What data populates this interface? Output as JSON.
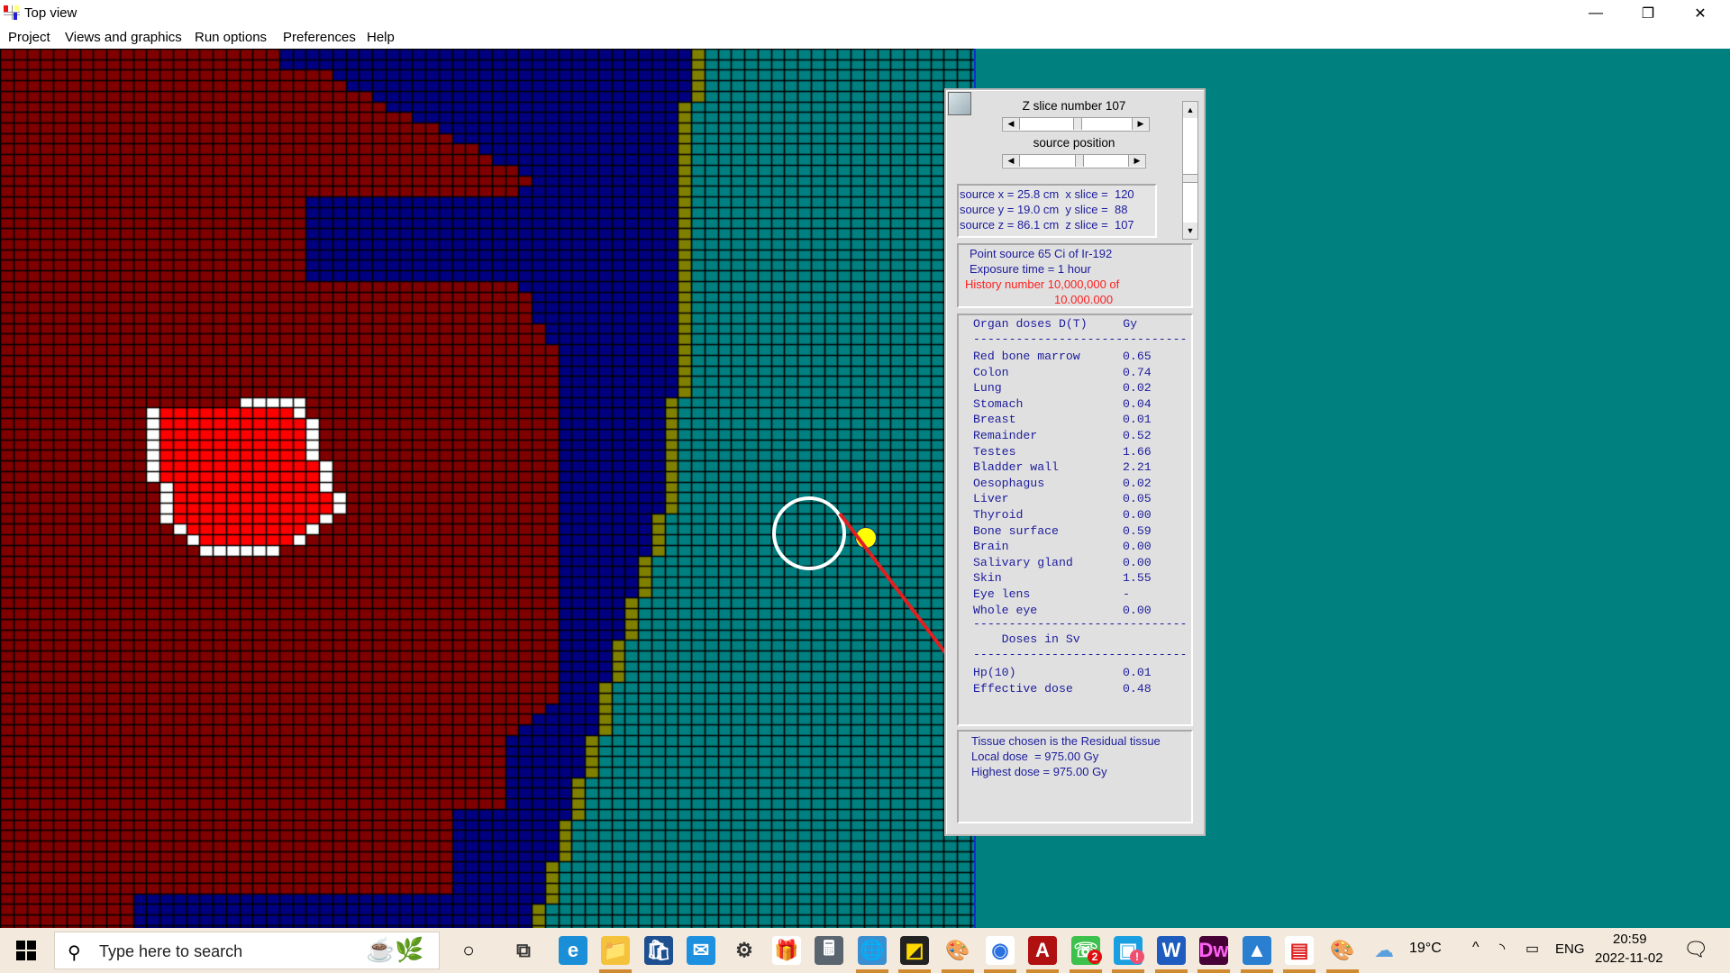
{
  "window": {
    "title": "Top view",
    "controls": {
      "minimize": "—",
      "restore": "❐",
      "close": "✕"
    }
  },
  "menu": [
    "Project",
    "Views and graphics",
    "Run options",
    "Preferences",
    "Help"
  ],
  "colors": {
    "tissue_soft": "#800000",
    "tissue_selected": "#ff0000",
    "tissue_selected_border": "#ffffff",
    "tissue_fat": "#000080",
    "tissue_skin": "#808000",
    "air": "#008080",
    "grid_line": "#000000",
    "source": "#ffff00",
    "annotation": "#e02020"
  },
  "panel": {
    "z_slice_label": "Z slice number 107",
    "z_slice_value": 107,
    "source_position_label": "source position",
    "source_coords": [
      "source x = 25.8 cm  x slice =  120",
      "source y = 19.0 cm  y slice =  88",
      "source z = 86.1 cm  z slice =  107"
    ],
    "source_info": {
      "line1": "Point source 65 Ci of Ir-192",
      "line2": "Exposure time = 1 hour",
      "history_line1": "History number 10,000,000 of",
      "history_line2": "10.000.000"
    },
    "organ_doses": {
      "header": "Organ doses D(T)     Gy",
      "separator": "------------------------------",
      "rows": [
        {
          "organ": "Red bone marrow",
          "value": "0.65"
        },
        {
          "organ": "Colon",
          "value": "0.74"
        },
        {
          "organ": "Lung",
          "value": "0.02"
        },
        {
          "organ": "Stomach",
          "value": "0.04"
        },
        {
          "organ": "Breast",
          "value": "0.01"
        },
        {
          "organ": "Remainder",
          "value": "0.52"
        },
        {
          "organ": "Testes",
          "value": "1.66"
        },
        {
          "organ": "Bladder wall",
          "value": "2.21"
        },
        {
          "organ": "Oesophagus",
          "value": "0.02"
        },
        {
          "organ": "Liver",
          "value": "0.05"
        },
        {
          "organ": "Thyroid",
          "value": "0.00"
        },
        {
          "organ": "Bone surface",
          "value": "0.59"
        },
        {
          "organ": "Brain",
          "value": "0.00"
        },
        {
          "organ": "Salivary gland",
          "value": "0.00"
        },
        {
          "organ": "Skin",
          "value": "1.55"
        },
        {
          "organ": "Eye lens",
          "value": "-"
        },
        {
          "organ": "Whole eye",
          "value": "0.00"
        }
      ],
      "sv_header": "    Doses in Sv",
      "sv_rows": [
        {
          "organ": "Hp(10)",
          "value": "0.01"
        },
        {
          "organ": "Effective dose",
          "value": "0.48"
        }
      ]
    },
    "tissue_info": {
      "line1": "Tissue chosen is the Residual tissue",
      "line2": "Local dose  = 975.00 Gy",
      "line3": "Highest dose = 975.00 Gy"
    }
  },
  "taskbar": {
    "search_placeholder": "Type here to search",
    "apps": [
      {
        "name": "task-view",
        "glyph": "⧉"
      },
      {
        "name": "edge",
        "glyph": "e"
      },
      {
        "name": "file-explorer",
        "glyph": "📁"
      },
      {
        "name": "microsoft-store",
        "glyph": "🛍"
      },
      {
        "name": "mail",
        "glyph": "✉"
      },
      {
        "name": "settings",
        "glyph": "⚙"
      },
      {
        "name": "gift",
        "glyph": "🎁"
      },
      {
        "name": "calculator",
        "glyph": "🖩"
      },
      {
        "name": "globe-download",
        "glyph": "🌐"
      },
      {
        "name": "sticky-notes",
        "glyph": "◩"
      },
      {
        "name": "paint",
        "glyph": "🎨"
      },
      {
        "name": "chrome",
        "glyph": "◉"
      },
      {
        "name": "acrobat",
        "glyph": "A"
      },
      {
        "name": "whatsapp",
        "glyph": "☏",
        "badge": "2"
      },
      {
        "name": "device-app",
        "glyph": "▣",
        "badge": "!"
      },
      {
        "name": "word",
        "glyph": "W"
      },
      {
        "name": "dreamweaver",
        "glyph": "Dw"
      },
      {
        "name": "photos",
        "glyph": "▲"
      },
      {
        "name": "dose-app",
        "glyph": "▤"
      },
      {
        "name": "paint-2",
        "glyph": "🎨"
      }
    ],
    "weather": "19°C",
    "language": "ENG",
    "time": "20:59",
    "date": "2022-11-02"
  }
}
